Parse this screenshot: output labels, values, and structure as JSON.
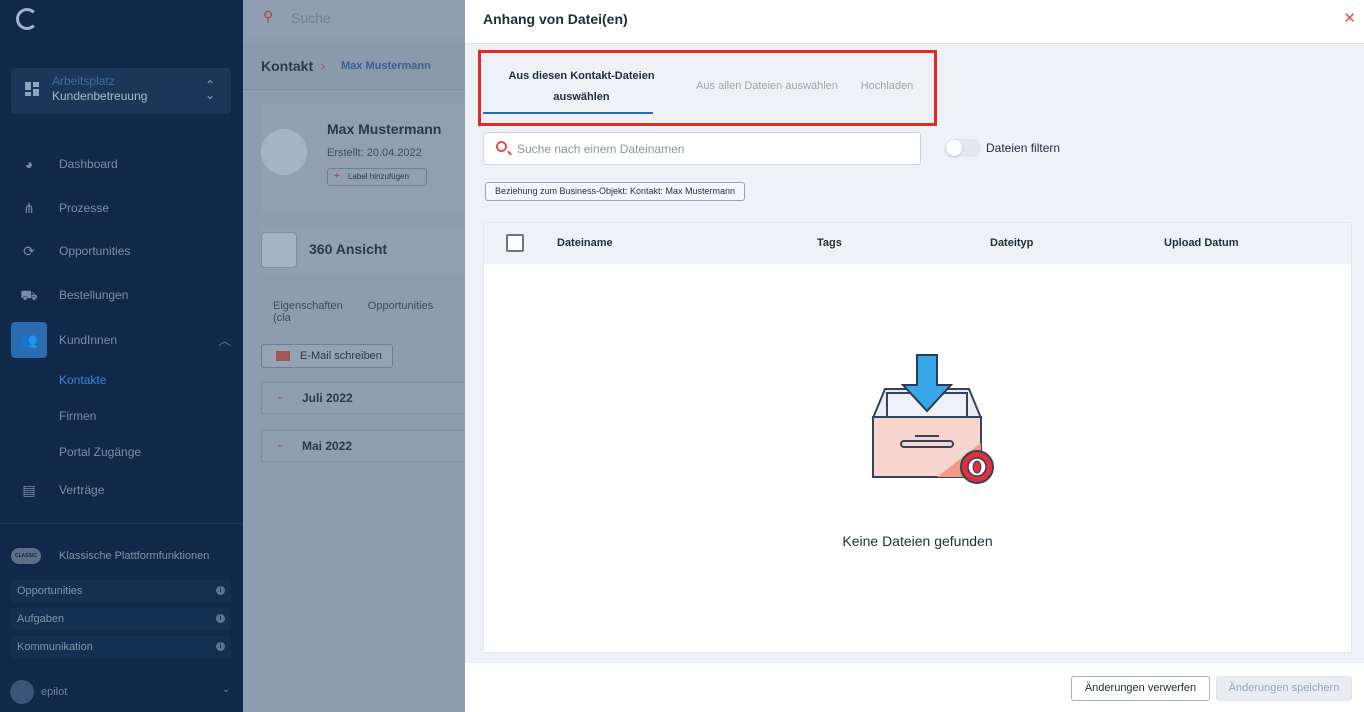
{
  "topbar": {
    "search_label": "Suche"
  },
  "sidebar": {
    "workspace": {
      "label": "Arbeitsplatz",
      "value": "Kundenbetreuung"
    },
    "nav": [
      {
        "label": "Dashboard",
        "icon": "pie-chart-icon"
      },
      {
        "label": "Prozesse",
        "icon": "hierarchy-icon"
      },
      {
        "label": "Opportunities",
        "icon": "refresh-icon"
      },
      {
        "label": "Bestellungen",
        "icon": "cart-icon"
      },
      {
        "label": "KundInnen",
        "icon": "users-icon"
      },
      {
        "label": "Verträge",
        "icon": "clipboard-icon"
      }
    ],
    "subnav": [
      {
        "label": "Kontakte"
      },
      {
        "label": "Firmen"
      },
      {
        "label": "Portal Zugänge"
      }
    ],
    "classic_badge": "CLASSIC",
    "classic_label": "Klassische Plattformfunktionen",
    "classic_items": [
      {
        "label": "Opportunities"
      },
      {
        "label": "Aufgaben"
      },
      {
        "label": "Kommunikation"
      }
    ],
    "user": "epilot"
  },
  "main": {
    "breadcrumb": {
      "root": "Kontakt",
      "current": "Max Mustermann"
    },
    "contact": {
      "name": "Max Mustermann",
      "created": "Erstellt: 20.04.2022",
      "add_label": "Label hinzufügen"
    },
    "view_title": "360 Ansicht",
    "tabs": [
      "Eigenschaften",
      "Opportunities (cla"
    ],
    "email_button": "E-Mail schreiben",
    "timeline": [
      "Juli 2022",
      "Mai 2022"
    ]
  },
  "modal": {
    "title": "Anhang von Datei(en)",
    "tabs": [
      {
        "label": "Aus diesen Kontakt-Dateien auswählen",
        "line1": "Aus diesen Kontakt-Dateien",
        "line2": "auswählen"
      },
      {
        "label": "Aus allen Dateien auswählen"
      },
      {
        "label": "Hochladen"
      }
    ],
    "search_placeholder": "Suche nach einem Dateinamen",
    "filter_label": "Dateien filtern",
    "filter_on": false,
    "chip": "Beziehung zum Business-Objekt: Kontakt: Max Mustermann",
    "columns": [
      "Dateiname",
      "Tags",
      "Dateityp",
      "Upload Datum"
    ],
    "empty_text": "Keine Dateien gefunden",
    "discard_button": "Änderungen verwerfen",
    "save_button": "Änderungen speichern",
    "highlight_color": "#e02a2a",
    "accent_color": "#2b6cb0"
  }
}
